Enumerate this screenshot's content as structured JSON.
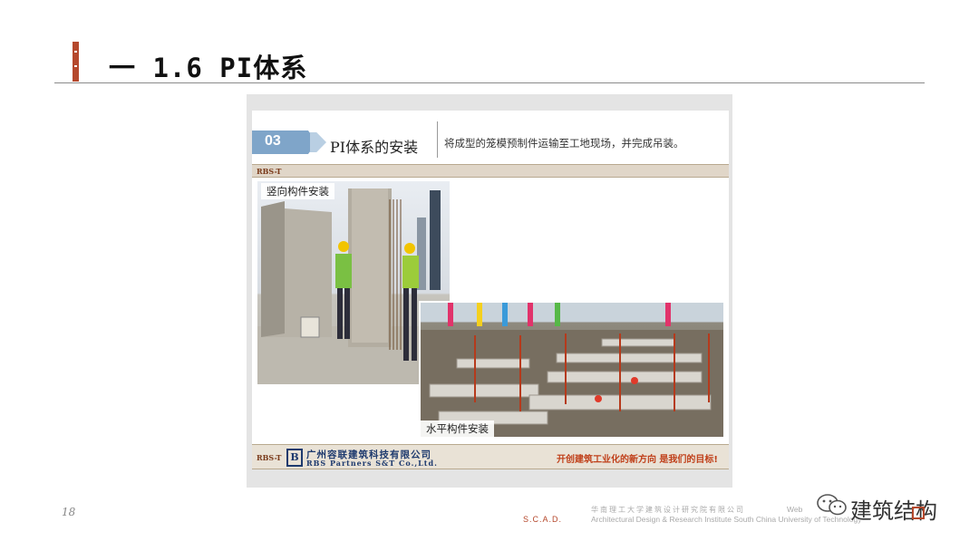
{
  "slide": {
    "title": "一 1.6 PI体系",
    "page_number": "18"
  },
  "inner_slide": {
    "step_number": "03",
    "step_title": "PI体系的安装",
    "step_description": "将成型的笼模预制件运输至工地现场，并完成吊装。",
    "band_logo": "RBS-T",
    "photos": {
      "vertical_label": "竖向构件安装",
      "horizontal_label": "水平构件安装"
    },
    "footer": {
      "band_logo": "RBS-T",
      "company_mark": "B",
      "company_cn": "广州容联建筑科技有限公司",
      "company_en": "RBS Partners S&T Co.,Ltd.",
      "slogan": "开创建筑工业化的新方向 是我们的目标!"
    }
  },
  "footer": {
    "scad": "S.C.A.D.",
    "institute_cn": "华南理工大学建筑设计研究院有限公司",
    "institute_en": "Architectural Design & Research Institute South China University of Technology",
    "web_label": "Web",
    "watermark": "建筑结构",
    "watermark_icon": "wechat-icon"
  },
  "colors": {
    "accent": "#b5482c",
    "step_tab": "#7fa5c9",
    "company_blue": "#1e3a6e",
    "slogan_red": "#c0401a"
  }
}
